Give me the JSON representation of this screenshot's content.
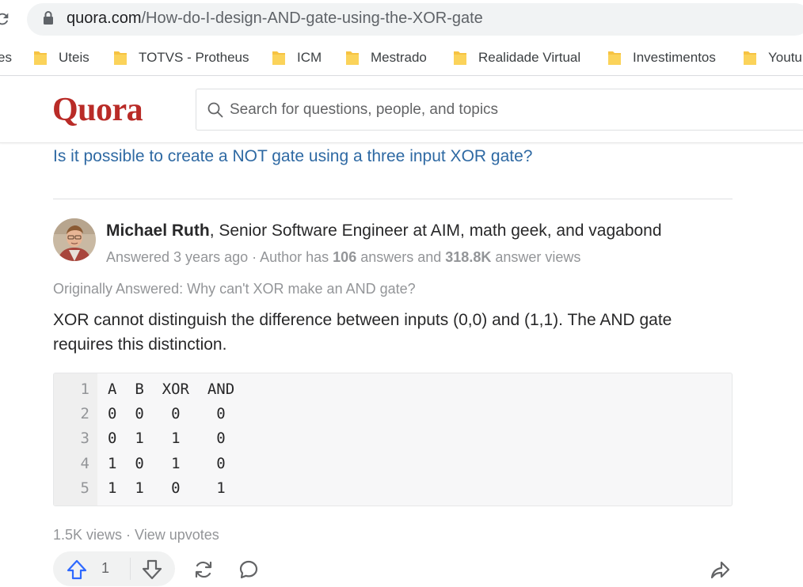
{
  "browser": {
    "url_host": "quora.com",
    "url_path": "/How-do-I-design-AND-gate-using-the-XOR-gate",
    "bookmarks_partial_left": "es",
    "bookmarks": [
      {
        "label": "Uteis"
      },
      {
        "label": "TOTVS - Protheus"
      },
      {
        "label": "ICM"
      },
      {
        "label": "Mestrado"
      },
      {
        "label": "Realidade Virtual"
      },
      {
        "label": "Investimentos"
      },
      {
        "label": "Youtu"
      }
    ]
  },
  "header": {
    "logo": "Quora",
    "search_placeholder": "Search for questions, people, and topics"
  },
  "related_question": "Is it possible to create a NOT gate using a three input XOR gate?",
  "answer": {
    "author_name": "Michael Ruth",
    "author_credential": ", Senior Software Engineer at AIM, math geek, and vagabond",
    "answered": "Answered 3 years ago",
    "meta_sep": " · Author has ",
    "answers_count": "106",
    "answers_label": " answers and ",
    "views_count": "318.8K",
    "views_label": " answer views",
    "originally_answered": "Originally Answered: Why can't XOR make an AND gate?",
    "text": "XOR cannot distinguish the difference between inputs (0,0) and (1,1). The AND gate requires this distinction.",
    "code": [
      {
        "ln": "1",
        "text": "A  B  XOR  AND"
      },
      {
        "ln": "2",
        "text": "0  0   0    0"
      },
      {
        "ln": "3",
        "text": "0  1   1    0"
      },
      {
        "ln": "4",
        "text": "1  0   1    0"
      },
      {
        "ln": "5",
        "text": "1  1   0    1"
      }
    ],
    "views": "1.5K views",
    "view_upvotes": " · View upvotes",
    "upvote_count": "1"
  },
  "colors": {
    "brand": "#b92b27",
    "link": "#2e69a3",
    "upvote": "#2e69ff",
    "folder": "#f6c343"
  },
  "icons": [
    "reload-icon",
    "lock-icon",
    "folder-icon",
    "search-icon",
    "upvote-icon",
    "downvote-icon",
    "reshare-icon",
    "comment-icon",
    "share-icon"
  ]
}
